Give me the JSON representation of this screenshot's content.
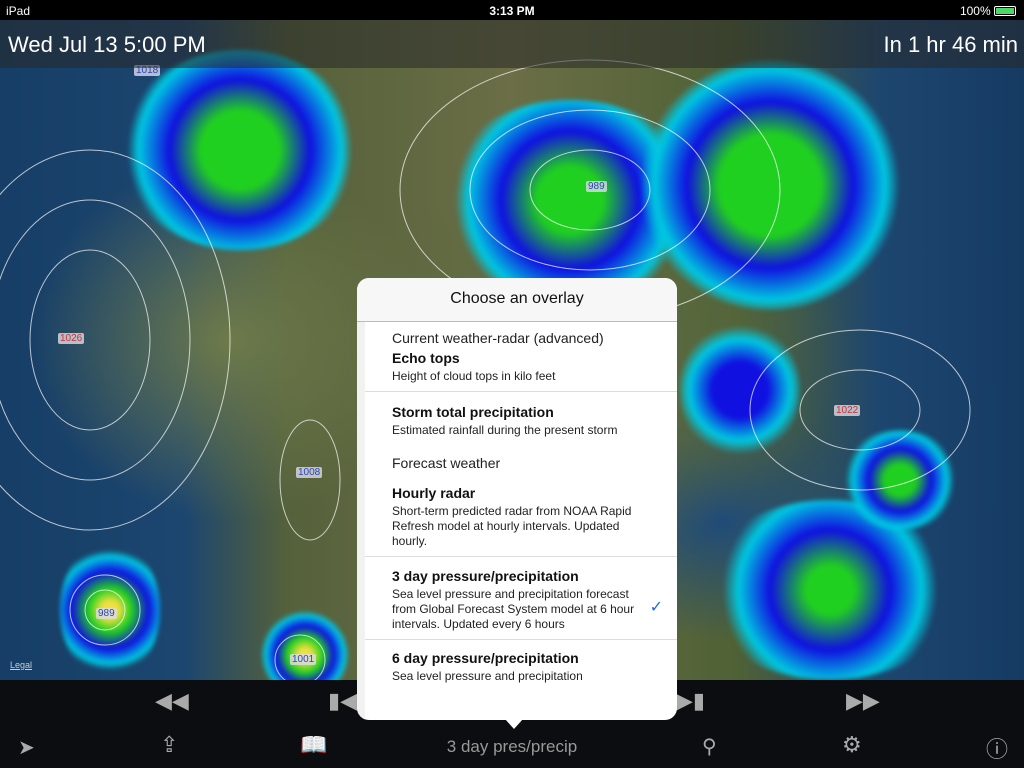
{
  "status": {
    "device": "iPad",
    "time": "3:13 PM",
    "battery": "100%"
  },
  "header": {
    "datetime": "Wed Jul 13 5:00 PM",
    "relative": "In 1 hr 46 min"
  },
  "map": {
    "pressure_labels": [
      "1018",
      "1026",
      "989",
      "1022",
      "1008",
      "989",
      "1001"
    ],
    "legal": "Legal"
  },
  "popover": {
    "title": "Choose an overlay",
    "sections": [
      {
        "label": "Current weather-radar (advanced)"
      },
      {
        "label": "Forecast weather"
      }
    ],
    "items": [
      {
        "title": "Echo tops",
        "desc": "Height of cloud tops in kilo feet"
      },
      {
        "title": "Storm total precipitation",
        "desc": "Estimated rainfall during the present storm"
      },
      {
        "title": "Hourly radar",
        "desc": "Short-term predicted radar from NOAA Rapid Refresh model at hourly intervals. Updated hourly."
      },
      {
        "title": "3 day pressure/precipitation",
        "desc": "Sea level pressure and precipitation forecast from Global Forecast System model at 6 hour intervals. Updated every 6 hours",
        "selected": true
      },
      {
        "title": "6 day pressure/precipitation",
        "desc": "Sea level pressure and precipitation"
      }
    ]
  },
  "toolbar": {
    "overlay_label": "3 day pres/precip",
    "icons": [
      "location-arrow-icon",
      "share-icon",
      "bookmarks-icon",
      "search-icon",
      "gear-icon",
      "info-icon"
    ],
    "playback": [
      "rewind-icon",
      "step-back-icon",
      "step-forward-icon",
      "fast-forward-icon"
    ]
  },
  "colors": {
    "accent": "#1a6ee0",
    "radar_light": "#00d8e8",
    "radar_mid": "#1010e0",
    "radar_heavy": "#20e020"
  }
}
